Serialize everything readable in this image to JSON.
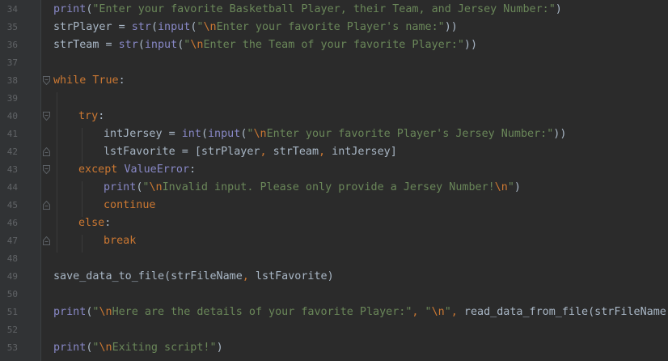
{
  "editor": {
    "lines": [
      {
        "n": "34",
        "indent": 0,
        "tokens": [
          {
            "t": "print",
            "k": "bi"
          },
          {
            "t": "(",
            "k": "pl"
          },
          {
            "t": "\"Enter your favorite Basketball Player, their Team, and Jersey Number:\"",
            "k": "str"
          },
          {
            "t": ")",
            "k": "pl"
          }
        ]
      },
      {
        "n": "35",
        "indent": 0,
        "tokens": [
          {
            "t": "strPlayer = ",
            "k": "pl"
          },
          {
            "t": "str",
            "k": "bi"
          },
          {
            "t": "(",
            "k": "pl"
          },
          {
            "t": "input",
            "k": "bi"
          },
          {
            "t": "(",
            "k": "pl"
          },
          {
            "t": "\"",
            "k": "str"
          },
          {
            "t": "\\n",
            "k": "esc"
          },
          {
            "t": "Enter your favorite Player's name:\"",
            "k": "str"
          },
          {
            "t": "))",
            "k": "pl"
          }
        ]
      },
      {
        "n": "36",
        "indent": 0,
        "tokens": [
          {
            "t": "strTeam = ",
            "k": "pl"
          },
          {
            "t": "str",
            "k": "bi"
          },
          {
            "t": "(",
            "k": "pl"
          },
          {
            "t": "input",
            "k": "bi"
          },
          {
            "t": "(",
            "k": "pl"
          },
          {
            "t": "\"",
            "k": "str"
          },
          {
            "t": "\\n",
            "k": "esc"
          },
          {
            "t": "Enter the Team of your favorite Player:\"",
            "k": "str"
          },
          {
            "t": "))",
            "k": "pl"
          }
        ]
      },
      {
        "n": "37",
        "indent": 0,
        "tokens": []
      },
      {
        "n": "38",
        "indent": 0,
        "fold": "open",
        "tokens": [
          {
            "t": "while ",
            "k": "kw"
          },
          {
            "t": "True",
            "k": "kw"
          },
          {
            "t": ":",
            "k": "pl"
          }
        ]
      },
      {
        "n": "39",
        "indent": 0,
        "tokens": []
      },
      {
        "n": "40",
        "indent": 1,
        "fold": "open",
        "tokens": [
          {
            "t": "try",
            "k": "kw"
          },
          {
            "t": ":",
            "k": "pl"
          }
        ]
      },
      {
        "n": "41",
        "indent": 2,
        "tokens": [
          {
            "t": "intJersey = ",
            "k": "pl"
          },
          {
            "t": "int",
            "k": "bi"
          },
          {
            "t": "(",
            "k": "pl"
          },
          {
            "t": "input",
            "k": "bi"
          },
          {
            "t": "(",
            "k": "pl"
          },
          {
            "t": "\"",
            "k": "str"
          },
          {
            "t": "\\n",
            "k": "esc"
          },
          {
            "t": "Enter your favorite Player's Jersey Number:\"",
            "k": "str"
          },
          {
            "t": "))",
            "k": "pl"
          }
        ]
      },
      {
        "n": "42",
        "indent": 2,
        "fold": "close",
        "tokens": [
          {
            "t": "lstFavorite = [strPlayer",
            "k": "pl"
          },
          {
            "t": ", ",
            "k": "kw"
          },
          {
            "t": "strTeam",
            "k": "pl"
          },
          {
            "t": ", ",
            "k": "kw"
          },
          {
            "t": "intJersey]",
            "k": "pl"
          }
        ]
      },
      {
        "n": "43",
        "indent": 1,
        "fold": "open",
        "tokens": [
          {
            "t": "except ",
            "k": "kw"
          },
          {
            "t": "ValueError",
            "k": "bi"
          },
          {
            "t": ":",
            "k": "pl"
          }
        ]
      },
      {
        "n": "44",
        "indent": 2,
        "tokens": [
          {
            "t": "print",
            "k": "bi"
          },
          {
            "t": "(",
            "k": "pl"
          },
          {
            "t": "\"",
            "k": "str"
          },
          {
            "t": "\\n",
            "k": "esc"
          },
          {
            "t": "Invalid input. Please only provide a Jersey Number!",
            "k": "str"
          },
          {
            "t": "\\n",
            "k": "esc"
          },
          {
            "t": "\"",
            "k": "str"
          },
          {
            "t": ")",
            "k": "pl"
          }
        ]
      },
      {
        "n": "45",
        "indent": 2,
        "fold": "close",
        "tokens": [
          {
            "t": "continue",
            "k": "kw"
          }
        ]
      },
      {
        "n": "46",
        "indent": 1,
        "tokens": [
          {
            "t": "else",
            "k": "kw"
          },
          {
            "t": ":",
            "k": "pl"
          }
        ]
      },
      {
        "n": "47",
        "indent": 2,
        "fold": "close",
        "tokens": [
          {
            "t": "break",
            "k": "kw"
          }
        ]
      },
      {
        "n": "48",
        "indent": 0,
        "tokens": []
      },
      {
        "n": "49",
        "indent": 0,
        "tokens": [
          {
            "t": "save_data_to_file(strFileName",
            "k": "pl"
          },
          {
            "t": ", ",
            "k": "kw"
          },
          {
            "t": "lstFavorite)",
            "k": "pl"
          }
        ]
      },
      {
        "n": "50",
        "indent": 0,
        "tokens": []
      },
      {
        "n": "51",
        "indent": 0,
        "tokens": [
          {
            "t": "print",
            "k": "bi"
          },
          {
            "t": "(",
            "k": "pl"
          },
          {
            "t": "\"",
            "k": "str"
          },
          {
            "t": "\\n",
            "k": "esc"
          },
          {
            "t": "Here are the details of your favorite Player:\"",
            "k": "str"
          },
          {
            "t": ", ",
            "k": "kw"
          },
          {
            "t": "\"",
            "k": "str"
          },
          {
            "t": "\\n",
            "k": "esc"
          },
          {
            "t": "\"",
            "k": "str"
          },
          {
            "t": ", ",
            "k": "kw"
          },
          {
            "t": "read_data_from_file(strFileName))",
            "k": "pl"
          }
        ]
      },
      {
        "n": "52",
        "indent": 0,
        "tokens": []
      },
      {
        "n": "53",
        "indent": 0,
        "tokens": [
          {
            "t": "print",
            "k": "bi"
          },
          {
            "t": "(",
            "k": "pl"
          },
          {
            "t": "\"",
            "k": "str"
          },
          {
            "t": "\\n",
            "k": "esc"
          },
          {
            "t": "Exiting script!\"",
            "k": "str"
          },
          {
            "t": ")",
            "k": "pl"
          }
        ]
      }
    ]
  },
  "colors": {
    "background": "#2b2b2b",
    "keyword": "#cc7832",
    "function": "#ffc66d",
    "builtin": "#8888c6",
    "string": "#6a8759",
    "plain": "#a9b7c6",
    "line_number": "#606366"
  }
}
